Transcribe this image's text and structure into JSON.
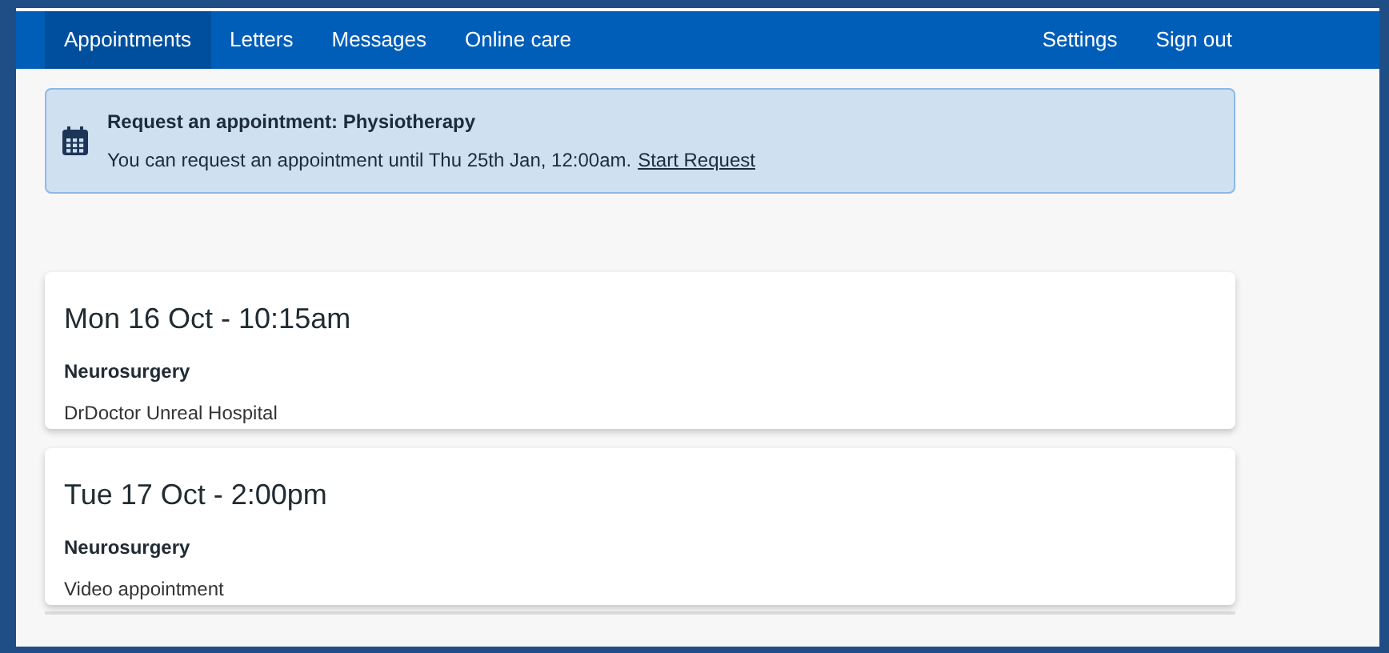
{
  "nav": {
    "left": [
      {
        "label": "Appointments",
        "selected": true
      },
      {
        "label": "Letters",
        "selected": false
      },
      {
        "label": "Messages",
        "selected": false
      },
      {
        "label": "Online care",
        "selected": false
      }
    ],
    "right": [
      {
        "label": "Settings",
        "selected": false
      },
      {
        "label": "Sign out",
        "selected": false
      }
    ]
  },
  "banner": {
    "title": "Request an appointment: Physiotherapy",
    "text": "You can request an appointment until Thu 25th Jan, 12:00am.",
    "link": "Start Request"
  },
  "appointments": [
    {
      "datetime": "Mon 16 Oct - 10:15am",
      "specialty": "Neurosurgery",
      "location": "DrDoctor Unreal Hospital"
    },
    {
      "datetime": "Tue 17 Oct - 2:00pm",
      "specialty": "Neurosurgery",
      "location": "Video appointment"
    }
  ]
}
